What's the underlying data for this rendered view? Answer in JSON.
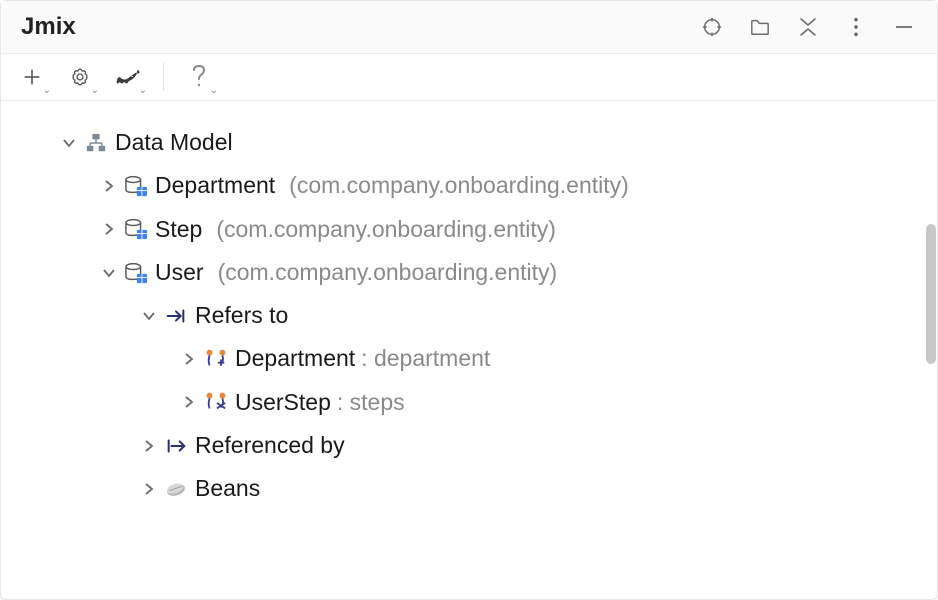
{
  "header": {
    "title": "Jmix"
  },
  "tree": {
    "root": {
      "label": "Data Model"
    },
    "items": [
      {
        "label": "Department",
        "pkg": "(com.company.onboarding.entity)"
      },
      {
        "label": "Step",
        "pkg": "(com.company.onboarding.entity)"
      },
      {
        "label": "User",
        "pkg": "(com.company.onboarding.entity)"
      }
    ],
    "refers_to": {
      "label": "Refers to"
    },
    "ref_items": [
      {
        "label": "Department",
        "prop": ": department"
      },
      {
        "label": "UserStep",
        "prop": ": steps"
      }
    ],
    "referenced_by": {
      "label": "Referenced by"
    },
    "beans": {
      "label": "Beans"
    }
  }
}
